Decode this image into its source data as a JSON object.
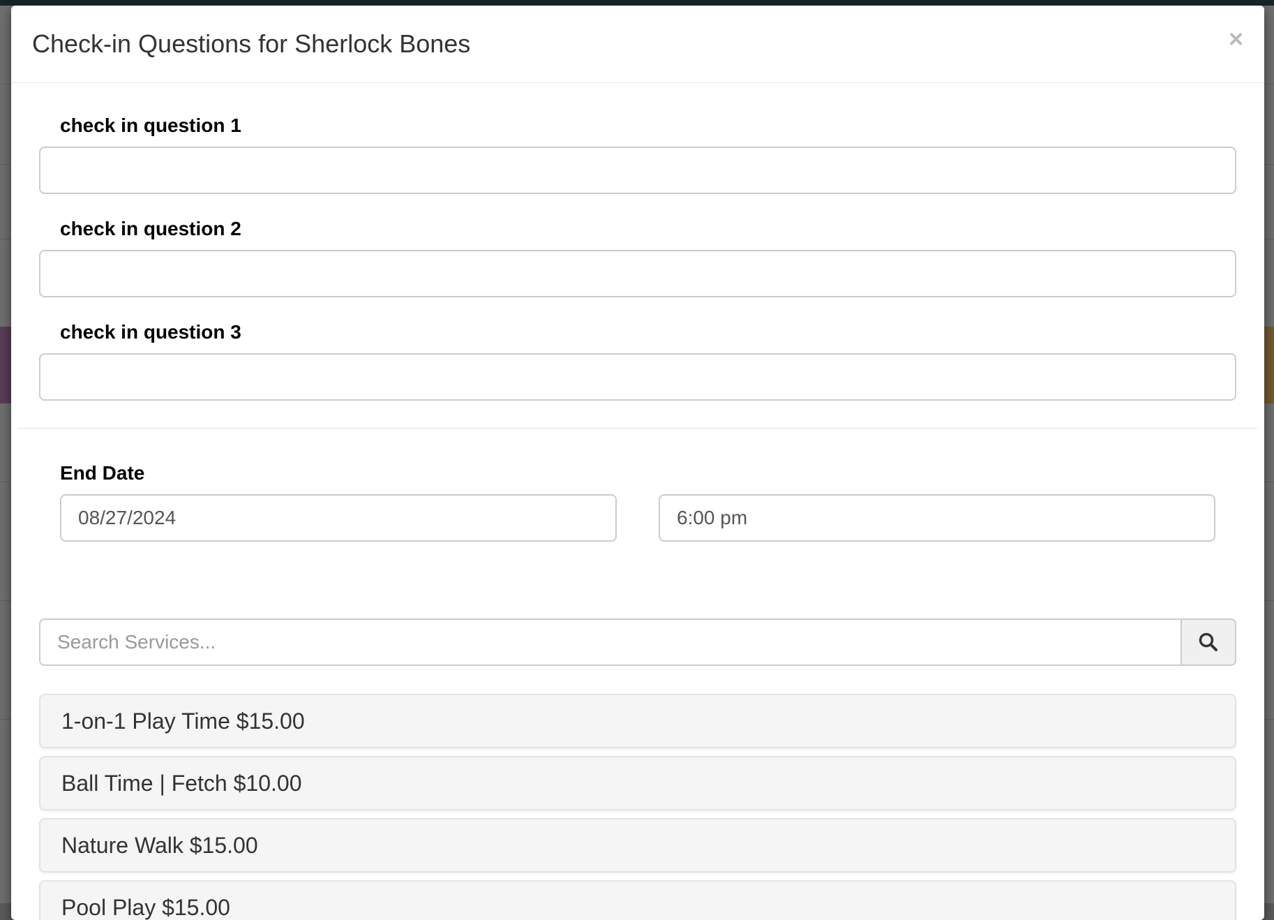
{
  "modal": {
    "title": "Check-in Questions for Sherlock Bones",
    "close_label": "×"
  },
  "questions": [
    {
      "label": "check in question 1",
      "value": ""
    },
    {
      "label": "check in question 2",
      "value": ""
    },
    {
      "label": "check in question 3",
      "value": ""
    }
  ],
  "end_date": {
    "label": "End Date",
    "date_value": "08/27/2024",
    "time_value": "6:00 pm"
  },
  "search": {
    "placeholder": "Search Services...",
    "icon": "search-icon"
  },
  "services": [
    {
      "label": "1-on-1 Play Time $15.00"
    },
    {
      "label": "Ball Time | Fetch $10.00"
    },
    {
      "label": "Nature Walk $15.00"
    },
    {
      "label": "Pool Play $15.00"
    }
  ]
}
